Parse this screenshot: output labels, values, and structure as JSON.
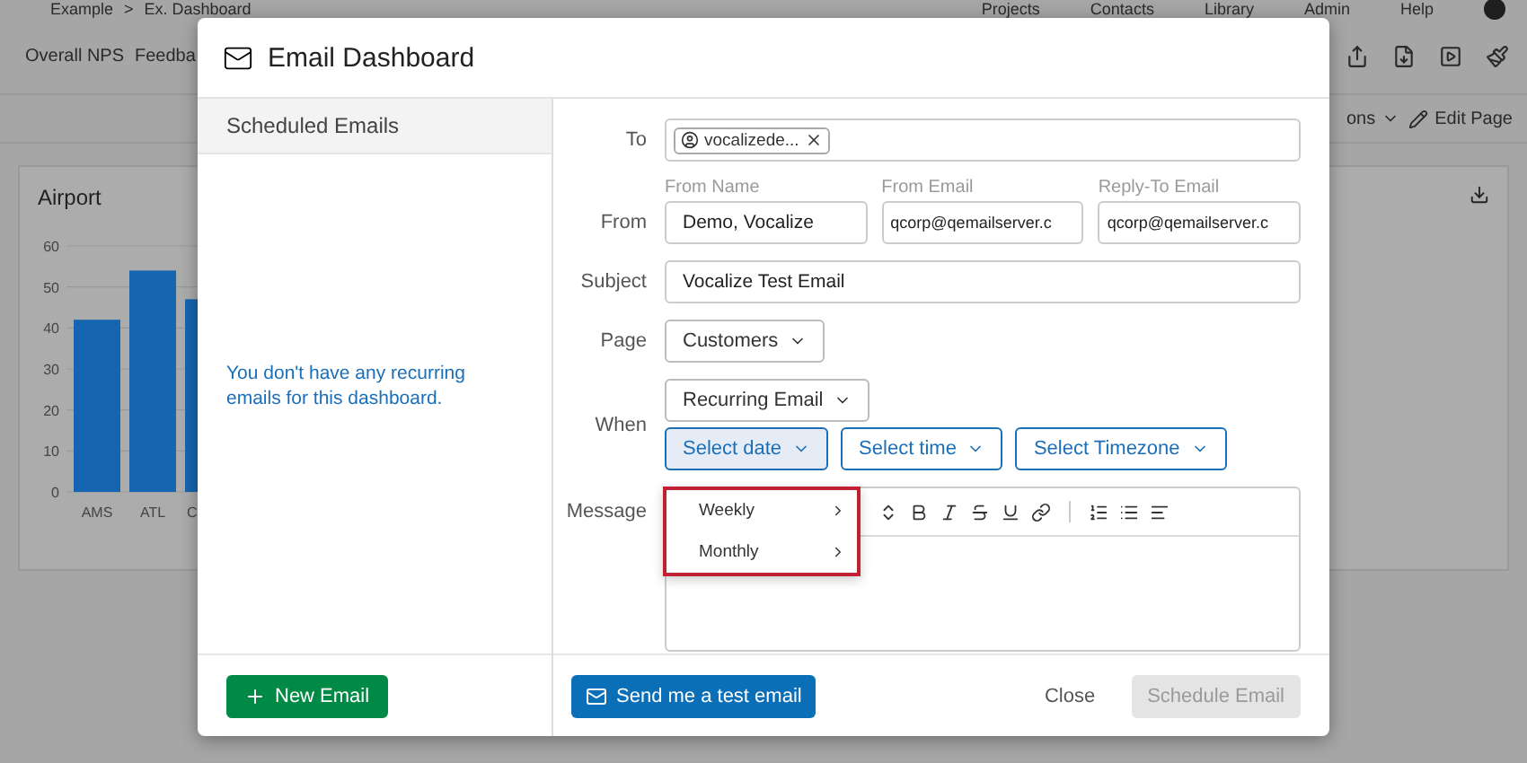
{
  "background": {
    "breadcrumb": [
      "Example",
      ">",
      "Ex. Dashboard"
    ],
    "top_links": [
      "Projects",
      "Contacts",
      "Library",
      "Admin",
      "Help"
    ],
    "page_tabs": [
      "Overall NPS",
      "Feedba"
    ],
    "toolbar": {
      "options_label": "ons",
      "edit_page": "Edit Page"
    },
    "card": {
      "chart_data": {
        "type": "bar",
        "grid": true,
        "categories": [
          "AMS",
          "ATL",
          "C"
        ],
        "yticks": [
          0,
          10,
          20,
          30,
          40,
          50,
          60
        ],
        "ylim": [
          0,
          60
        ],
        "series": [
          {
            "name": "Airport",
            "color": "#1565b0",
            "values": [
              42,
              54,
              47
            ]
          }
        ]
      }
    }
  },
  "dialog": {
    "title": "Email Dashboard",
    "sidebar": {
      "header": "Scheduled Emails",
      "empty_message": "You don't have any recurring emails for this dashboard.",
      "new_button": "New Email"
    },
    "form": {
      "to": {
        "label": "To",
        "recipients": [
          "vocalizede..."
        ]
      },
      "from": {
        "label": "From",
        "fields": [
          {
            "label": "From Name",
            "value": "Demo, Vocalize"
          },
          {
            "label": "From Email",
            "value": "qcorp@qemailserver.c"
          },
          {
            "label": "Reply-To Email",
            "value": "qcorp@qemailserver.c"
          }
        ]
      },
      "subject": {
        "label": "Subject",
        "value": "Vocalize Test Email"
      },
      "page": {
        "label": "Page",
        "value": "Customers"
      },
      "when": {
        "label": "When",
        "value": "Recurring Email",
        "selects": [
          {
            "label": "Select date",
            "selected": true
          },
          {
            "label": "Select time",
            "selected": false
          },
          {
            "label": "Select Timezone",
            "selected": false
          }
        ]
      },
      "date_menu": {
        "items": [
          {
            "label": "Weekly"
          },
          {
            "label": "Monthly"
          }
        ]
      },
      "message": {
        "label": "Message"
      }
    },
    "footer": {
      "test_button": "Send me a test email",
      "close": "Close",
      "schedule": {
        "label": "Schedule Email",
        "disabled": true
      }
    }
  }
}
